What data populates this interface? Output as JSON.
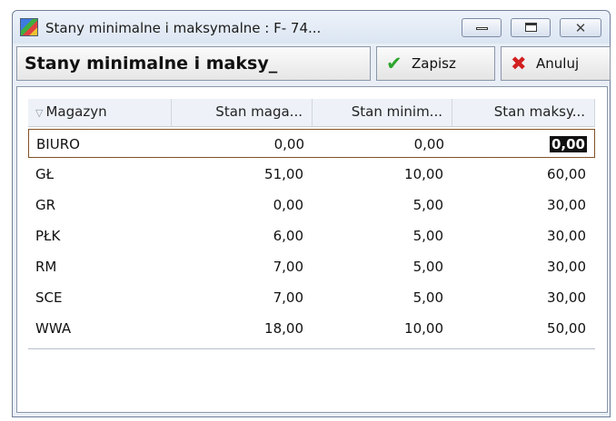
{
  "window": {
    "title": "Stany minimalne i maksymalne : F- 74...",
    "app_icon": "colorful-grid-icon"
  },
  "toolbar": {
    "heading": "Stany minimalne i maksy_",
    "save_label": "Zapisz",
    "save_icon": "checkmark-icon",
    "cancel_label": "Anuluj",
    "cancel_icon": "x-icon"
  },
  "table": {
    "headers": [
      "Magazyn",
      "Stan maga...",
      "Stan minim...",
      "Stan maksy..."
    ],
    "rows": [
      {
        "magazyn": "BIURO",
        "stan": "0,00",
        "min": "0,00",
        "max": "0,00"
      },
      {
        "magazyn": "GŁ",
        "stan": "51,00",
        "min": "10,00",
        "max": "60,00"
      },
      {
        "magazyn": "GR",
        "stan": "0,00",
        "min": "5,00",
        "max": "30,00"
      },
      {
        "magazyn": "PŁK",
        "stan": "6,00",
        "min": "5,00",
        "max": "30,00"
      },
      {
        "magazyn": "RM",
        "stan": "7,00",
        "min": "5,00",
        "max": "30,00"
      },
      {
        "magazyn": "SCE",
        "stan": "7,00",
        "min": "5,00",
        "max": "30,00"
      },
      {
        "magazyn": "WWA",
        "stan": "18,00",
        "min": "10,00",
        "max": "50,00"
      }
    ]
  },
  "colors": {
    "save_icon": "#2da52d",
    "cancel_icon": "#d21f1f",
    "selection_border": "#8b5a2b"
  }
}
